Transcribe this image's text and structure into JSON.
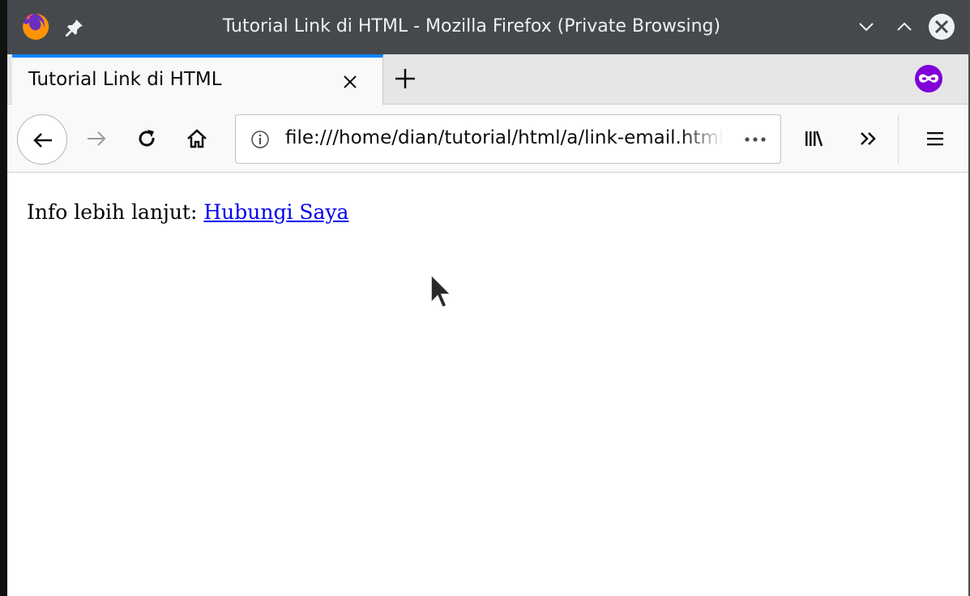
{
  "window": {
    "title": "Tutorial Link di HTML - Mozilla Firefox (Private Browsing)"
  },
  "tabs": [
    {
      "label": "Tutorial Link di HTML",
      "active": true
    }
  ],
  "toolbar": {
    "url": "file:///home/dian/tutorial/html/a/link-email.html"
  },
  "page": {
    "text": "Info lebih lanjut:",
    "link_label": "Hubungi Saya"
  },
  "colors": {
    "titlebar": "#45494e",
    "tab_accent": "#0a84ff",
    "private_badge": "#8000d7",
    "link": "#0000ee"
  },
  "icons": {
    "app": "firefox-icon",
    "pin": "pin-icon",
    "minimize": "chevron-down-icon",
    "maximize": "chevron-up-icon",
    "close": "close-circle-icon",
    "private": "private-browsing-mask-icon"
  }
}
